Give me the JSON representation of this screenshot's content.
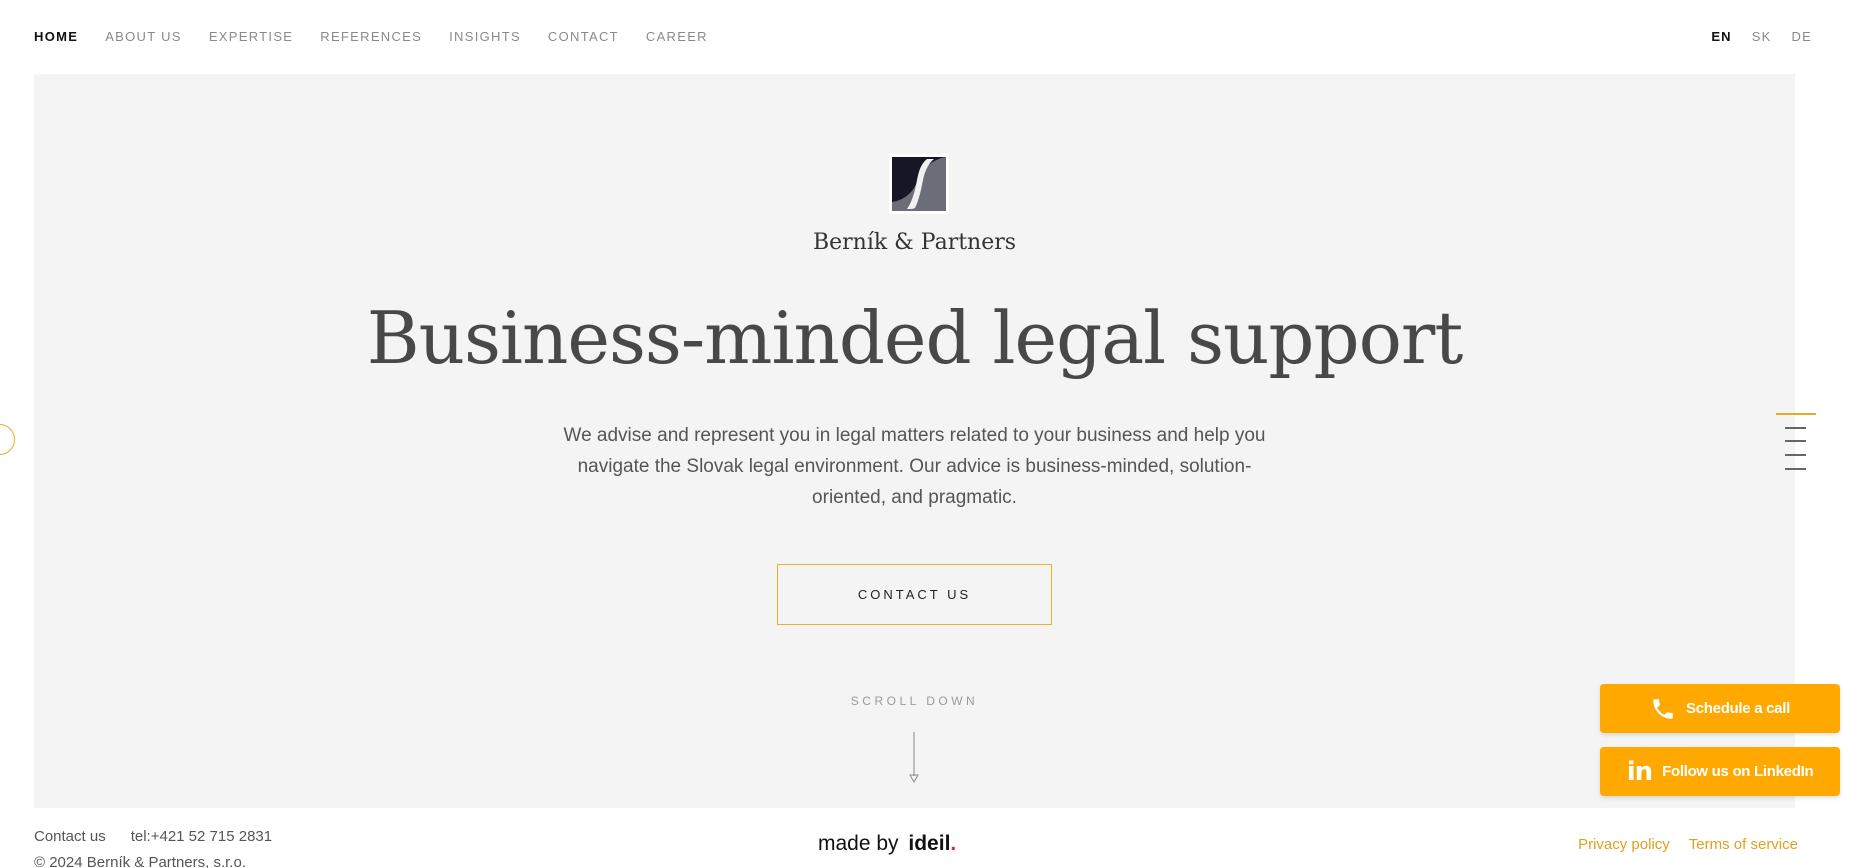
{
  "nav": {
    "items": [
      {
        "label": "HOME",
        "active": true
      },
      {
        "label": "ABOUT US",
        "active": false
      },
      {
        "label": "EXPERTISE",
        "active": false
      },
      {
        "label": "REFERENCES",
        "active": false
      },
      {
        "label": "INSIGHTS",
        "active": false
      },
      {
        "label": "CONTACT",
        "active": false
      },
      {
        "label": "CAREER",
        "active": false
      }
    ],
    "languages": [
      {
        "label": "EN",
        "active": true
      },
      {
        "label": "SK",
        "active": false
      },
      {
        "label": "DE",
        "active": false
      }
    ]
  },
  "hero": {
    "brand_name": "Berník & Partners",
    "headline": "Business-minded legal support",
    "lead": "We advise and represent you in legal matters related to your business and help you navigate the Slovak legal environment. Our advice is business-minded, solution-oriented, and pragmatic.",
    "cta_label": "CONTACT US",
    "scroll_label": "SCROLL DOWN",
    "logo_icon": "s-monogram-logo",
    "slide_count": 5,
    "active_slide": 1
  },
  "floating": {
    "call_label": "Schedule a call",
    "call_icon": "phone-icon",
    "linkedin_label": "Follow us on LinkedIn",
    "linkedin_icon": "linkedin-icon"
  },
  "footer": {
    "contact_label": "Contact us",
    "phone": "tel:+421 52 715 2831",
    "copyright": "© 2024 Berník & Partners, s.r.o.",
    "made_by_prefix": "made by",
    "made_by_brand": "ideil",
    "made_by_dot": ".",
    "privacy_label": "Privacy policy",
    "terms_label": "Terms of service"
  },
  "colors": {
    "accent": "#ffa800",
    "accent_border": "#e8b12c",
    "hero_bg": "#f4f4f4",
    "logo_dark": "#161625",
    "logo_gray": "#6b6e78"
  }
}
